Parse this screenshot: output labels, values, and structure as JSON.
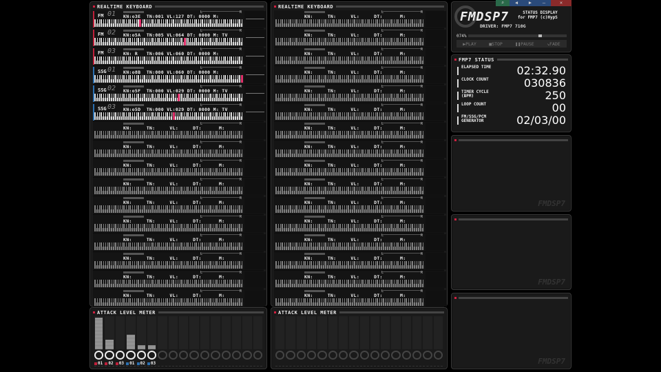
{
  "colors": {
    "fm": "#c0203a",
    "ssg": "#2a6fb0",
    "accent": "#e0306a"
  },
  "left": {
    "title": "REALTIME KEYBOARD",
    "channels": [
      {
        "type": "FM",
        "num": "01",
        "kn": "o3E",
        "tn": "001",
        "vl": "127",
        "dt": "0000",
        "m": "",
        "key_position": 0.3
      },
      {
        "type": "FM",
        "num": "02",
        "kn": "o5A",
        "tn": "005",
        "vl": "064",
        "dt": "0000",
        "m": "TV",
        "key_position": 0.6
      },
      {
        "type": "FM",
        "num": "03",
        "kn": " R ",
        "tn": "006",
        "vl": "060",
        "dt": "0000",
        "m": "",
        "key_position": null
      },
      {
        "type": "SSG",
        "num": "01",
        "kn": "o8B",
        "tn": "000",
        "vl": "060",
        "dt": "0000",
        "m": "",
        "key_position": 1.0
      },
      {
        "type": "SSG",
        "num": "02",
        "kn": "o5F",
        "tn": "000",
        "vl": "029",
        "dt": "0000",
        "m": "TV",
        "key_position": 0.56
      },
      {
        "type": "SSG",
        "num": "03",
        "kn": "o5D",
        "tn": "000",
        "vl": "029",
        "dt": "0000",
        "m": "TV",
        "key_position": 0.53
      },
      {},
      {},
      {},
      {},
      {},
      {},
      {},
      {},
      {},
      {}
    ]
  },
  "right": {
    "title": "REALTIME KEYBOARD",
    "channels": [
      {},
      {},
      {},
      {},
      {},
      {},
      {},
      {},
      {},
      {},
      {},
      {},
      {},
      {},
      {},
      {}
    ]
  },
  "fields": {
    "kn": "KN:",
    "tn": "TN:",
    "vl": "VL:",
    "dt": "DT:",
    "m": "M:",
    "pan_l": "L",
    "pan_r": "R"
  },
  "meter_left": {
    "title": "ATTACK LEVEL METER",
    "levels": [
      0.95,
      0.3,
      0,
      0.43,
      0.13,
      0.13,
      0,
      0,
      0,
      0,
      0,
      0,
      0,
      0,
      0,
      0
    ],
    "labels": [
      {
        "text": "01",
        "kind": "fm"
      },
      {
        "text": "02",
        "kind": "fm"
      },
      {
        "text": "03",
        "kind": "fm"
      },
      {
        "text": "01",
        "kind": "ssg"
      },
      {
        "text": "02",
        "kind": "ssg"
      },
      {
        "text": "03",
        "kind": "ssg"
      },
      {},
      {},
      {},
      {},
      {},
      {},
      {},
      {},
      {},
      {}
    ]
  },
  "meter_right": {
    "title": "ATTACK LEVEL METER",
    "levels": [
      0,
      0,
      0,
      0,
      0,
      0,
      0,
      0,
      0,
      0,
      0,
      0,
      0,
      0,
      0,
      0
    ]
  },
  "header": {
    "logo": "FMDSP7",
    "subtitle1": "STATUS DISPLAY",
    "subtitle2": "for FMP7 (c)HypS",
    "driver": "DRIVER: FMP7  710G",
    "progress_label": "074%",
    "progress": 0.74,
    "window_buttons": [
      "⌕",
      "◀",
      "▶",
      "—",
      "✕"
    ],
    "controls": {
      "play": "▶PLAY",
      "stop": "■STOP",
      "pause": "❚❚PAUSE",
      "fade": "↘FADE"
    }
  },
  "status": {
    "title": "FMP7 STATUS",
    "items": [
      {
        "label": "ELAPSED TIME",
        "value": "02:32.90"
      },
      {
        "label": "CLOCK COUNT",
        "value": "030836"
      },
      {
        "label": "TIMER CYCLE\n(BPM)",
        "value": "250"
      },
      {
        "label": "LOOP COUNT",
        "value": "00"
      },
      {
        "label": "FM/SSG/PCM\nGENERATOR",
        "value": "02/03/00"
      }
    ]
  },
  "empty_panels": {
    "watermark": "FMDSP7"
  }
}
